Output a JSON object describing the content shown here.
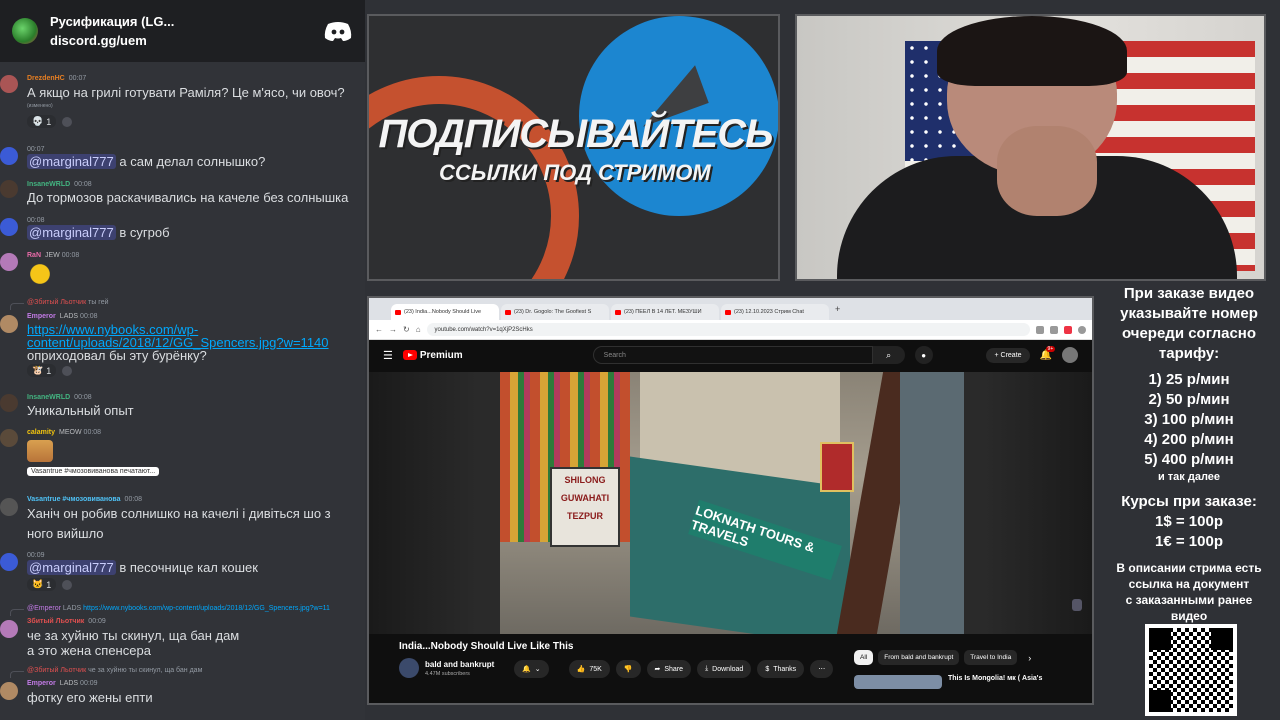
{
  "discord": {
    "server_name": "Русификация (LG...",
    "server_link": "discord.gg/uem",
    "messages": [
      {
        "author": "DrezdenHC",
        "time": "00:07",
        "text": "А якщо на грилі готувати Раміля? Це м'ясо, чи овоч?",
        "edited": "(изменено)",
        "reaction_count": "1"
      },
      {
        "time": "00:07",
        "mention": "@marginal777",
        "text": "а сам делал солнышко?"
      },
      {
        "author": "InsaneWRLD",
        "time": "00:08",
        "text": "До тормозов раскачивались на качеле без солнышка"
      },
      {
        "time": "00:08",
        "mention": "@marginal777",
        "text": "в сугроб"
      },
      {
        "author": "RaN",
        "badge": "JEW",
        "time": "00:08"
      },
      {
        "reply_author": "@Збитый Льотчик",
        "reply_text": "ты гей",
        "author": "Emperor",
        "badge": "LADS",
        "time": "00:08",
        "link": "https://www.nybooks.com/wp-content/uploads/2018/12/GG_Spencers.jpg?w=1140",
        "link_line1": "https://www.nybooks.com/wp-",
        "link_line2": "content/uploads/2018/12/GG_Spencers.jpg?w=1140",
        "text": "оприходовал бы эту бурёнку?",
        "reaction_count": "1"
      },
      {
        "author": "InsaneWRLD",
        "time": "00:08",
        "text": "Уникальный опыт"
      },
      {
        "author": "calamity",
        "badge": "MEOW",
        "time": "00:08",
        "typing": "Vasantrue #чмозовиванова печатают..."
      },
      {
        "author": "Vasantrue #чмозовиванова",
        "time": "00:08",
        "text1": "Ханіч он робив солнишко на качелі і дивіться шо з",
        "text2": "ного вийшло"
      },
      {
        "time": "00:09",
        "mention": "@marginal777",
        "text": "в песочнице кал кошек",
        "reaction_count": "1"
      },
      {
        "reply_author": "@Emperor",
        "reply_badge": "LADS",
        "reply_text": "https://www.nybooks.com/wp-content/uploads/2018/12/GG_Spencers.jpg?w=11",
        "author": "Збитый Льотчик",
        "time": "00:09",
        "text1": "че за хуйню ты скинул, ща бан дам",
        "text2": "а это жена спенсера"
      },
      {
        "reply_author": "@Збитый Льотчик",
        "reply_text": "че за хуйню ты скинул, ща бан дам",
        "author": "Emperor",
        "badge": "LADS",
        "time": "00:09",
        "text": "фотку его жены епти"
      }
    ]
  },
  "promo": {
    "title": "ПОДПИСЫВАЙТЕСЬ",
    "subtitle": "ССЫЛКИ ПОД СТРИМОМ"
  },
  "browser": {
    "tabs": [
      "(23) India...Nobody Should Live",
      "(23) Dr. Gogolo: The Goofiest S",
      "(23) ПЕЕЛ В 14 ЛЕТ. МЕЗУШИ",
      "(23) 12.10.2023 Стрим Chat"
    ],
    "url": "youtube.com/watch?v=1qXjP2ScHks",
    "yt": {
      "logo": "Premium",
      "search_placeholder": "Search",
      "create_label": "Create",
      "notification_count": "9+",
      "video_title": "India...Nobody Should Live Like This",
      "channel_name": "bald and bankrupt",
      "subscribers": "4.47M subscribers",
      "likes": "75K",
      "share": "Share",
      "download": "Download",
      "thanks": "Thanks",
      "chips": [
        "All",
        "From bald and bankrupt",
        "Travel to India"
      ],
      "rec_title": "This Is Mongolia! мк ( Asia's",
      "video_signs": {
        "sign1": "SHILONG",
        "sign2": "GUWAHATI",
        "sign3": "TEZPUR",
        "banner": "LOKNATH TOURS & TRAVELS"
      }
    }
  },
  "prices": {
    "intro": [
      "При заказе видео",
      "указывайте номер",
      "очереди согласно",
      "тарифу:"
    ],
    "tiers": [
      "1) 25 р/мин",
      "2) 50 р/мин",
      "3) 100 р/мин",
      "4) 200 р/мин",
      "5) 400 р/мин"
    ],
    "etc": "и так далее",
    "rates_title": "Курсы при заказе:",
    "rates": [
      "1$ = 100р",
      "1€ = 100р"
    ],
    "desc": [
      "В описании стрима есть",
      "ссылка на документ",
      "с заказанными ранее",
      "видео"
    ]
  },
  "colors": {
    "discord_bg": "#313338",
    "yt_red": "#ff0000",
    "telegram_blue": "#1c86d0"
  }
}
